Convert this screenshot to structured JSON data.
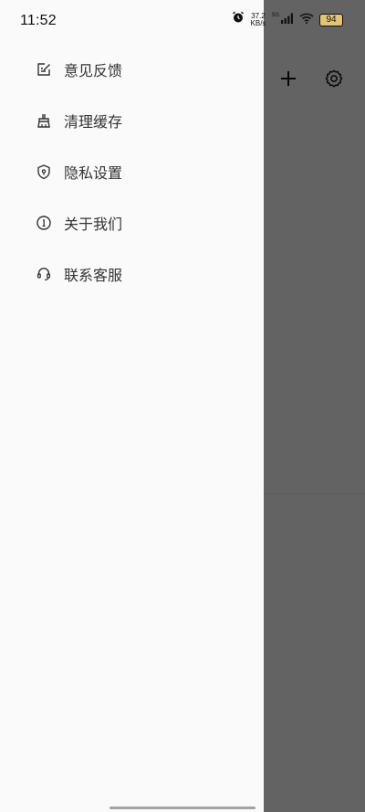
{
  "status_bar": {
    "time": "11:52",
    "net_speed_value": "37.2",
    "net_speed_unit": "KB/s",
    "network_type": "5G",
    "battery": "94"
  },
  "drawer": {
    "items": [
      {
        "label": "意见反馈",
        "icon": "feedback-icon"
      },
      {
        "label": "清理缓存",
        "icon": "broom-icon"
      },
      {
        "label": "隐私设置",
        "icon": "shield-icon"
      },
      {
        "label": "关于我们",
        "icon": "info-icon"
      },
      {
        "label": "联系客服",
        "icon": "headset-icon"
      }
    ]
  },
  "background": {
    "actions": [
      {
        "name": "add",
        "icon": "plus-icon"
      },
      {
        "name": "settings",
        "icon": "gear-icon"
      }
    ]
  },
  "colors": {
    "drawer_bg": "#fafafa",
    "scrim": "#666666",
    "text": "#333333",
    "battery_fill": "#e3c476"
  }
}
